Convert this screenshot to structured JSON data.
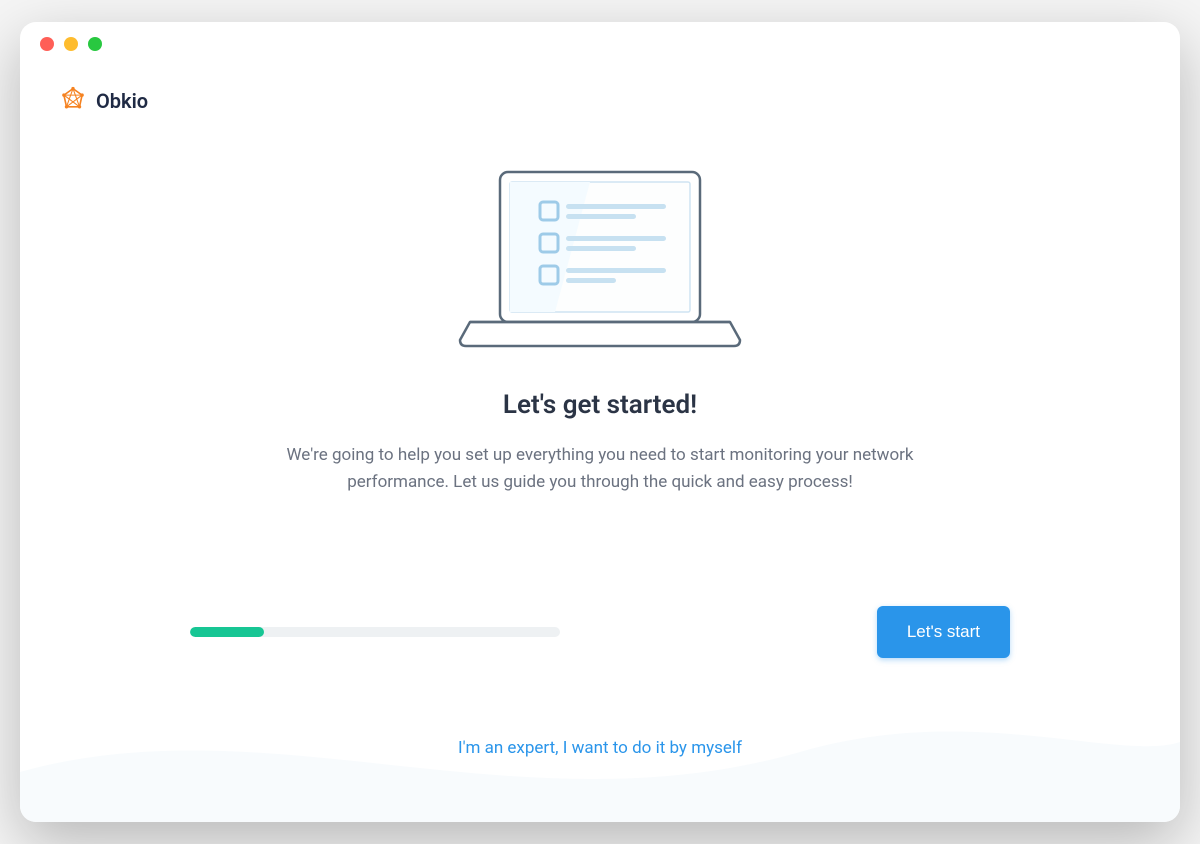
{
  "brand": {
    "name": "Obkio",
    "accentColor": "#f58220"
  },
  "onboarding": {
    "title": "Let's get started!",
    "subtitle": "We're going to help you set up everything you need to start monitoring your network performance. Let us guide you through the quick and easy process!",
    "progress": {
      "percent": 20,
      "fillColor": "#17c694",
      "trackColor": "#eef1f3"
    },
    "primaryButton": "Let's start",
    "skipLink": "I'm an expert, I want to do it by myself"
  },
  "colors": {
    "primary": "#2a95ea",
    "text": "#2b3445",
    "muted": "#6b7280"
  }
}
